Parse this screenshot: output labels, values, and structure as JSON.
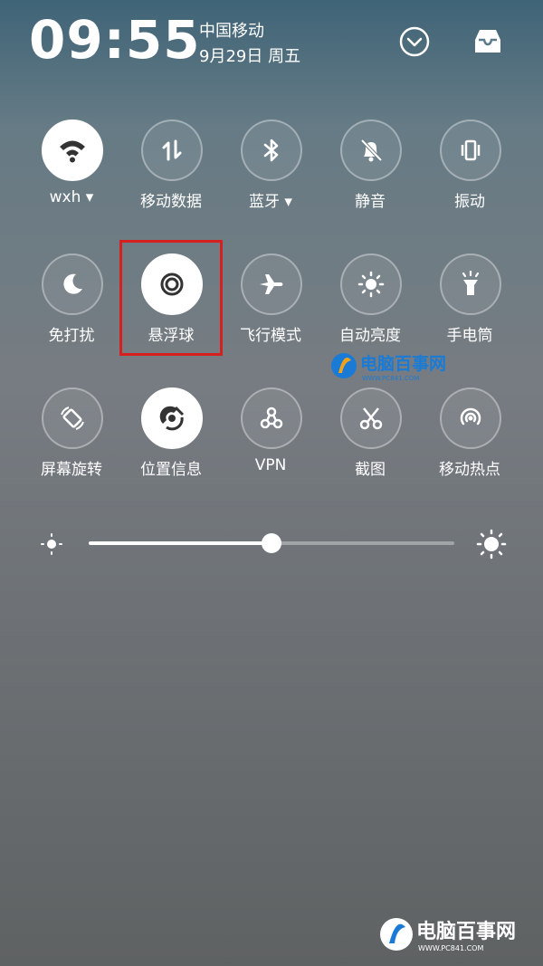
{
  "status_bar": {
    "time": "09:55",
    "carrier": "中国移动",
    "date": "9月29日 周五"
  },
  "tiles": [
    {
      "label": "wxh ▾",
      "icon": "wifi-icon",
      "active": true
    },
    {
      "label": "移动数据",
      "icon": "mobile-data-icon",
      "active": false
    },
    {
      "label": "蓝牙 ▾",
      "icon": "bluetooth-icon",
      "active": false
    },
    {
      "label": "静音",
      "icon": "mute-icon",
      "active": false
    },
    {
      "label": "振动",
      "icon": "vibrate-icon",
      "active": false
    },
    {
      "label": "免打扰",
      "icon": "moon-icon",
      "active": false
    },
    {
      "label": "悬浮球",
      "icon": "floating-ball-icon",
      "active": true
    },
    {
      "label": "飞行模式",
      "icon": "airplane-icon",
      "active": false
    },
    {
      "label": "自动亮度",
      "icon": "auto-brightness-icon",
      "active": false
    },
    {
      "label": "手电筒",
      "icon": "flashlight-icon",
      "active": false
    },
    {
      "label": "屏幕旋转",
      "icon": "rotate-screen-icon",
      "active": false
    },
    {
      "label": "位置信息",
      "icon": "location-icon",
      "active": true
    },
    {
      "label": "VPN",
      "icon": "vpn-icon",
      "active": false
    },
    {
      "label": "截图",
      "icon": "screenshot-icon",
      "active": false
    },
    {
      "label": "移动热点",
      "icon": "hotspot-icon",
      "active": false
    }
  ],
  "brightness": {
    "level": 0.5
  },
  "watermark": {
    "name": "电脑百事网",
    "url": "WWW.PC841.COM"
  },
  "colors": {
    "highlight": "#d62020",
    "watermark": "#1a7bd6"
  }
}
